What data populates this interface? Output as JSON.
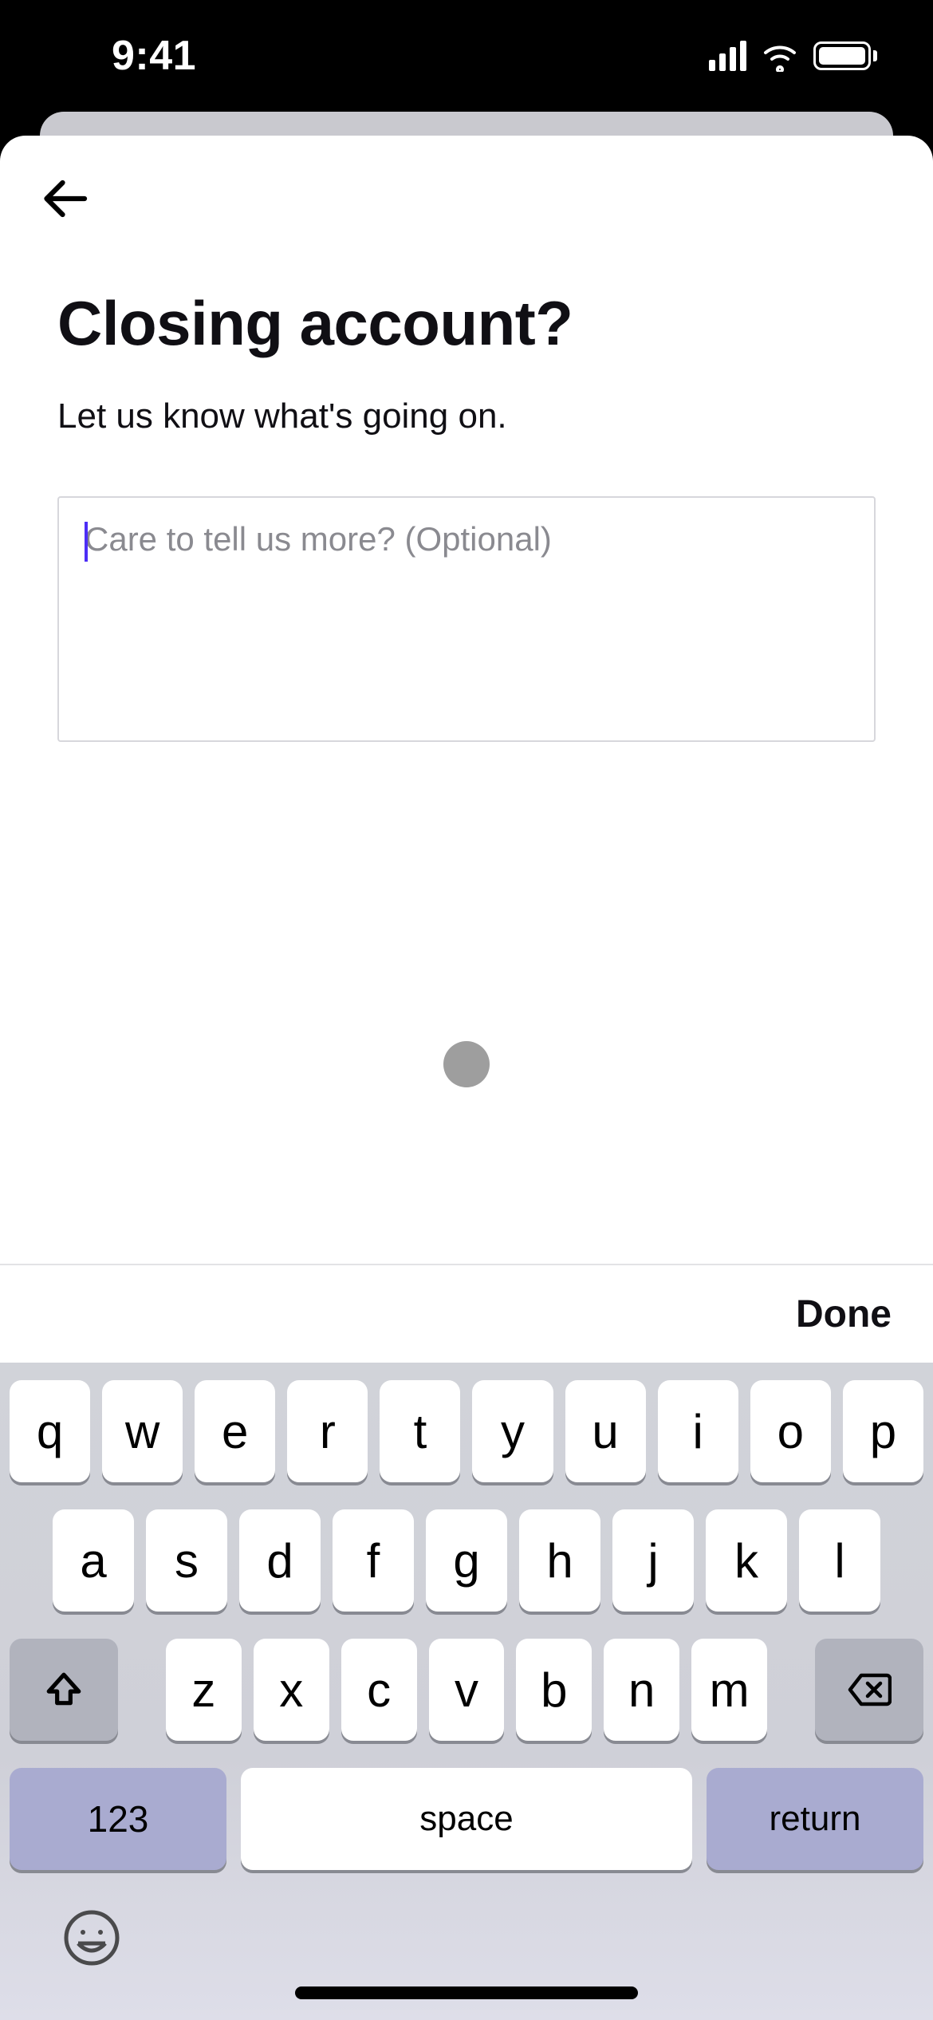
{
  "status": {
    "time": "9:41"
  },
  "page": {
    "title": "Closing account?",
    "subtitle": "Let us know what's going on.",
    "textarea_placeholder": "Care to tell us more? (Optional)",
    "textarea_value": ""
  },
  "accessory": {
    "done": "Done"
  },
  "keyboard": {
    "rows": [
      [
        "q",
        "w",
        "e",
        "r",
        "t",
        "y",
        "u",
        "i",
        "o",
        "p"
      ],
      [
        "a",
        "s",
        "d",
        "f",
        "g",
        "h",
        "j",
        "k",
        "l"
      ],
      [
        "z",
        "x",
        "c",
        "v",
        "b",
        "n",
        "m"
      ]
    ],
    "num": "123",
    "space": "space",
    "return": "return"
  }
}
